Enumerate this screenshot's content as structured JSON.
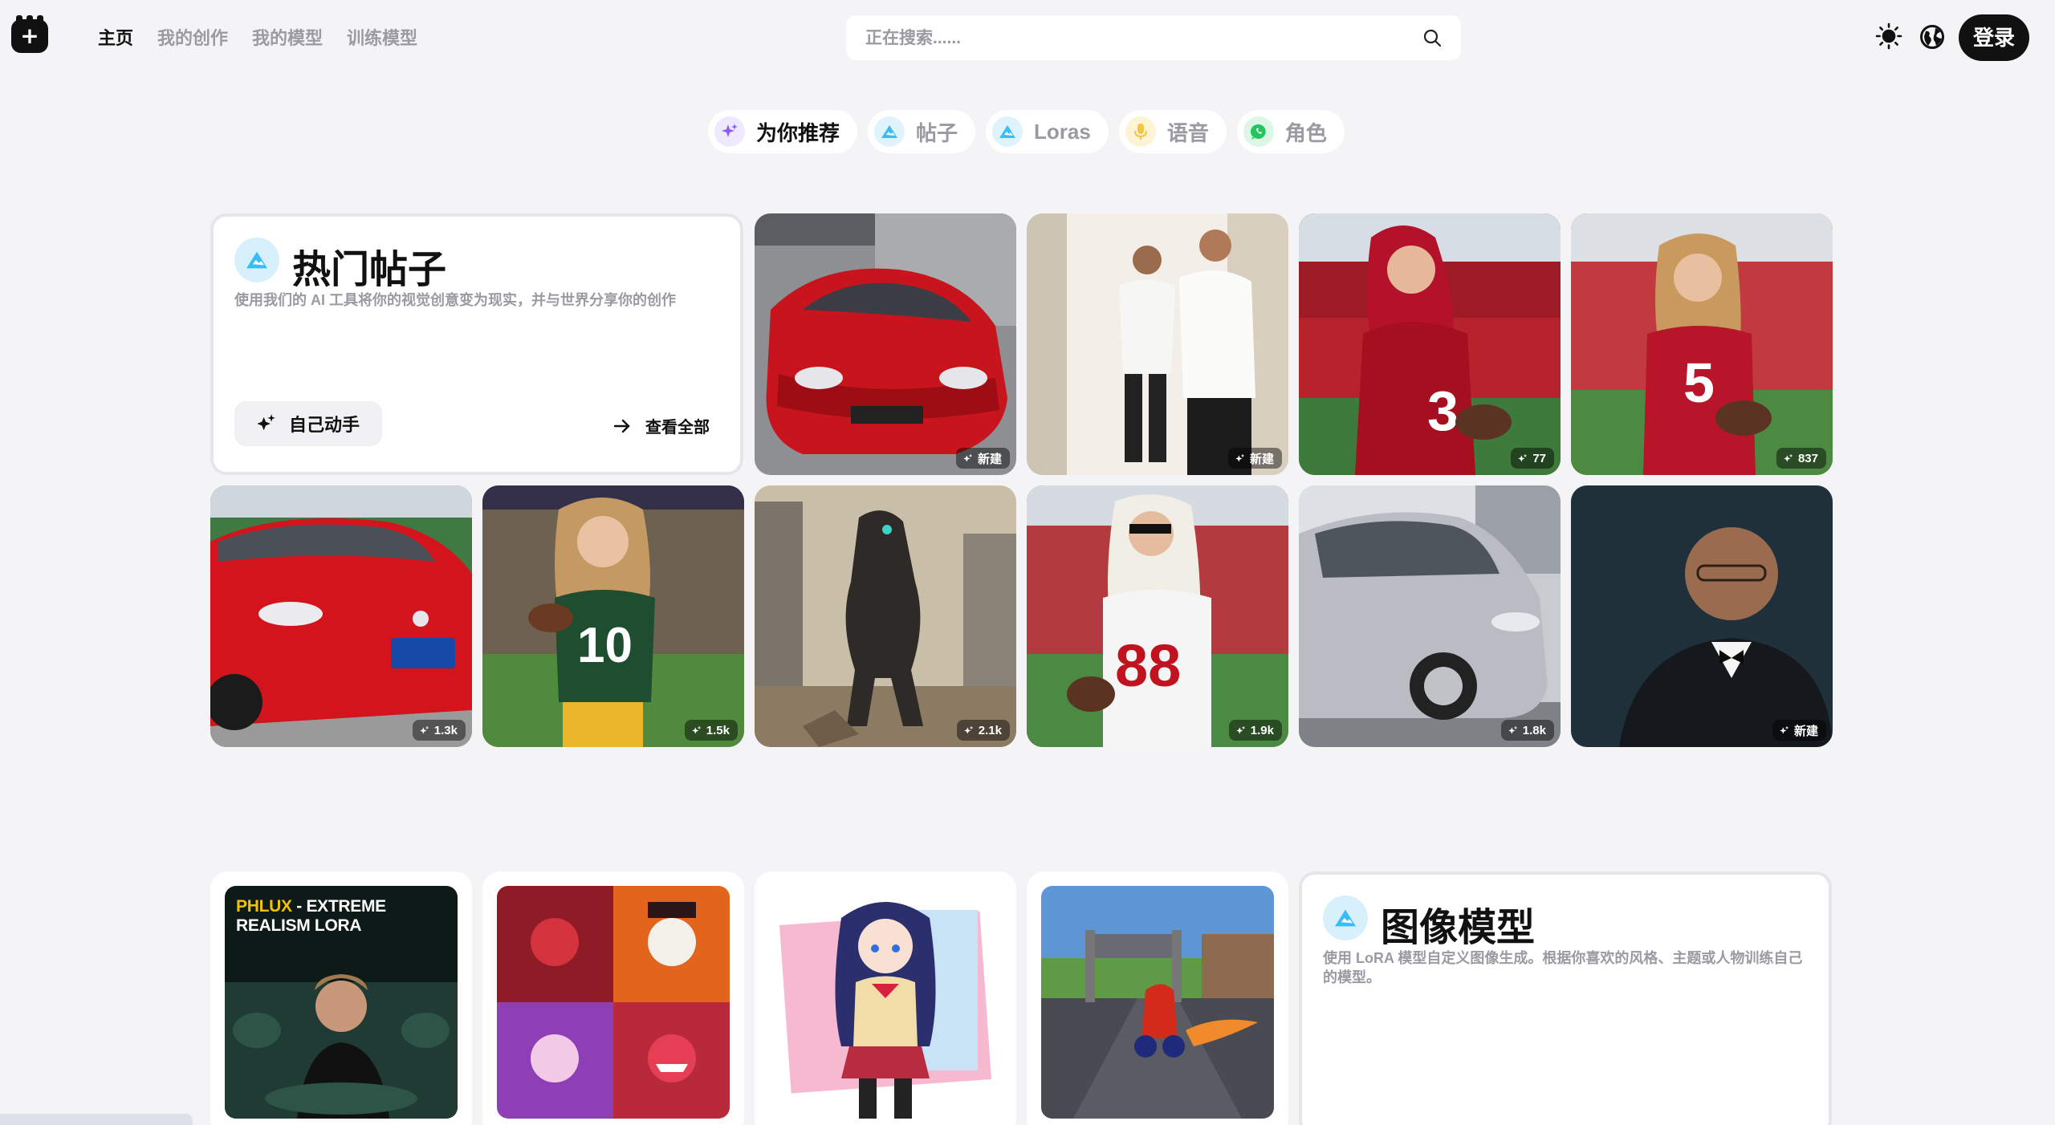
{
  "logo": {
    "glyph": "+"
  },
  "nav": [
    "主页",
    "我的创作",
    "我的模型",
    "训练模型"
  ],
  "search": {
    "placeholder": "正在搜索......"
  },
  "header": {
    "login": "登录"
  },
  "pills": [
    {
      "label": "为你推荐",
      "icon": "sparkle-icon",
      "color": "#8b5cf6"
    },
    {
      "label": "帖子",
      "icon": "mountain-icon",
      "color": "#38bdf8"
    },
    {
      "label": "Loras",
      "icon": "mountain-icon",
      "color": "#38bdf8"
    },
    {
      "label": "语音",
      "icon": "microphone-icon",
      "color": "#f5c542"
    },
    {
      "label": "角色",
      "icon": "chat-icon",
      "color": "#22c55e"
    }
  ],
  "featured": {
    "title": "热门帖子",
    "description": "使用我们的 AI 工具将你的视觉创意变为现实，并与世界分享你的创作",
    "diy_button": "自己动手",
    "view_all": "查看全部"
  },
  "posts": [
    {
      "subject": "red-sports-car",
      "badge": "新建"
    },
    {
      "subject": "mirror-selfie-men",
      "badge": "新建"
    },
    {
      "subject": "football-player-3",
      "badge": "77"
    },
    {
      "subject": "football-player-5",
      "badge": "837"
    },
    {
      "subject": "red-sedan",
      "badge": "1.3k"
    },
    {
      "subject": "green-bay-player-10",
      "badge": "1.5k"
    },
    {
      "subject": "armored-warrior",
      "badge": "2.1k"
    },
    {
      "subject": "georgia-player-88",
      "badge": "1.9k"
    },
    {
      "subject": "silver-minivan",
      "badge": "1.8k"
    },
    {
      "subject": "man-in-tuxedo",
      "badge": "新建"
    }
  ],
  "models": {
    "title": "图像模型",
    "description": "使用 LoRA 模型自定义图像生成。根据你喜欢的风格、主题或人物训练自己的模型。",
    "items": [
      {
        "subject": "phlux-realism",
        "label_prefix": "PHLUX",
        "label_rest": " - EXTREME REALISM LORA"
      },
      {
        "subject": "hazbin-characters-grid"
      },
      {
        "subject": "anime-schoolgirl"
      },
      {
        "subject": "racing-game"
      }
    ]
  }
}
